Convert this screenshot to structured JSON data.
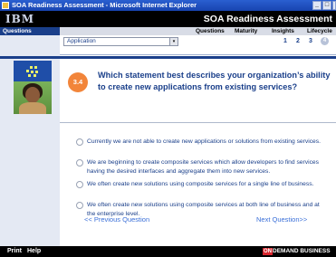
{
  "window": {
    "title": "SOA Readiness Assessment - Microsoft Internet Explorer",
    "icon": "ie-page-icon",
    "controls": [
      "minimize-icon",
      "maximize-icon",
      "close-icon"
    ]
  },
  "header": {
    "logo": "IBM",
    "app_title": "SOA Readiness Assessment"
  },
  "nav": {
    "section_label": "Questions",
    "links": [
      "Questions",
      "Maturity",
      "Insights",
      "Lifecycle"
    ]
  },
  "selector": {
    "value": "Application",
    "arrow": "▾"
  },
  "pager": {
    "pages": [
      "1",
      "2",
      "3"
    ],
    "current": "4"
  },
  "question": {
    "number": "3.4",
    "text": "Which statement best describes your organization’s ability to create new applications from existing services?"
  },
  "options": [
    "Currently we are not able to create new applications or solutions from existing services.",
    "We are beginning to create composite services which allow developers to find services having the desired interfaces and aggregate them into new services.",
    "We often create new solutions using composite services for a single line of business.",
    "We often create new solutions using composite services at both line of business and at the enterprise level."
  ],
  "navigation": {
    "previous": "<< Previous Question",
    "next": "Next Question>>"
  },
  "footer": {
    "print": "Print",
    "help": "Help",
    "on_mark": "ON",
    "tagline": "DEMAND BUSINESS"
  },
  "colors": {
    "brand_blue": "#1a3f8a",
    "badge_orange": "#f2853a",
    "link_blue": "#3a6fd8",
    "on_demand_red": "#d8262e"
  }
}
